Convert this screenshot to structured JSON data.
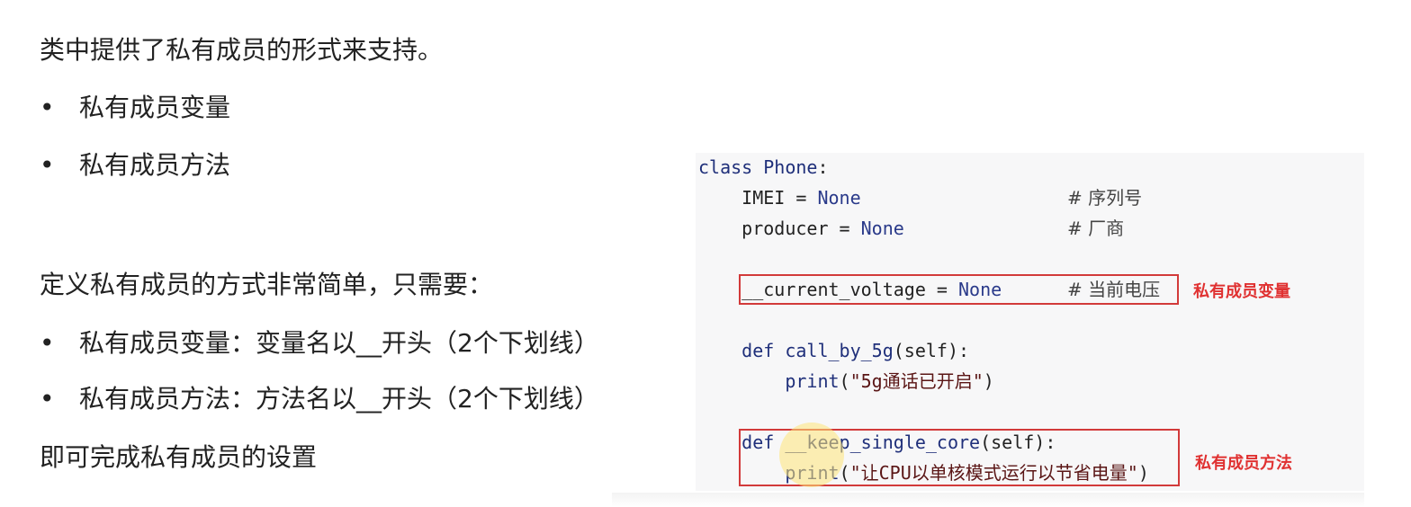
{
  "intro": "类中提供了私有成员的形式来支持。",
  "bullets_top": [
    {
      "dot": "•",
      "text": "私有成员变量"
    },
    {
      "dot": "•",
      "text": "私有成员方法"
    }
  ],
  "define": "定义私有成员的方式非常简单，只需要：",
  "bullets_rules": [
    {
      "dot": "•",
      "text": "私有成员变量：变量名以__开头（2个下划线）"
    },
    {
      "dot": "•",
      "text": "私有成员方法：方法名以__开头（2个下划线）"
    }
  ],
  "finish": "即可完成私有成员的设置",
  "code": {
    "l1_kw": "class",
    "l1_name": "Phone",
    "l1_colon": ":",
    "l2_var": "    IMEI = ",
    "l2_val": "None",
    "l2_cm": "# 序列号",
    "l3_var": "    producer = ",
    "l3_val": "None",
    "l3_cm": "# 厂商",
    "l4_var": "    __current_voltage = ",
    "l4_val": "None",
    "l4_cm": "# 当前电压",
    "l5_kw": "    def",
    "l5_fn": "call_by_5g",
    "l5_rest": "(self):",
    "l6_fn": "        print",
    "l6_open": "(",
    "l6_str": "\"5g通话已开启\"",
    "l6_close": ")",
    "l7_kw": "    def",
    "l7_fn": "__keep_single_core",
    "l7_rest": "(self):",
    "l8_fn": "        print",
    "l8_open": "(",
    "l8_str": "\"让CPU以单核模式运行以节省电量\"",
    "l8_close": ")"
  },
  "notes": {
    "var": "私有成员变量",
    "method": "私有成员方法"
  },
  "colors": {
    "frame": "#d23a3a",
    "note": "#e03131",
    "keyword": "#1f2f7a"
  }
}
